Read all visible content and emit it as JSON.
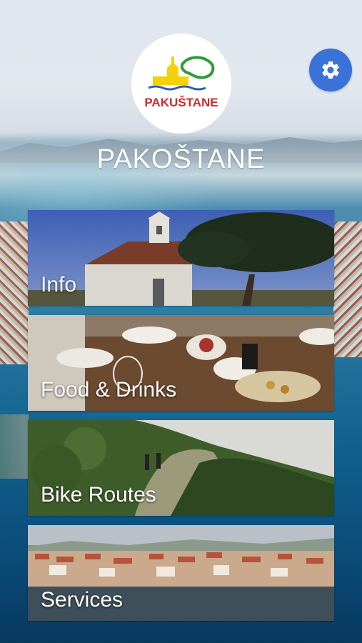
{
  "app": {
    "title": "PAKOŠTANE",
    "logo_text": "PAKUŠTANE"
  },
  "header": {
    "settings_icon": "gear-icon"
  },
  "menu": {
    "items": [
      {
        "label": "Info"
      },
      {
        "label": "Food & Drinks"
      },
      {
        "label": "Bike Routes"
      },
      {
        "label": "Services"
      }
    ]
  },
  "colors": {
    "settings_button": "#3a72d8",
    "logo_red": "#d32b2b",
    "logo_green": "#2e9b3a",
    "logo_yellow": "#f4d20a",
    "logo_blue": "#2b5fb8"
  }
}
